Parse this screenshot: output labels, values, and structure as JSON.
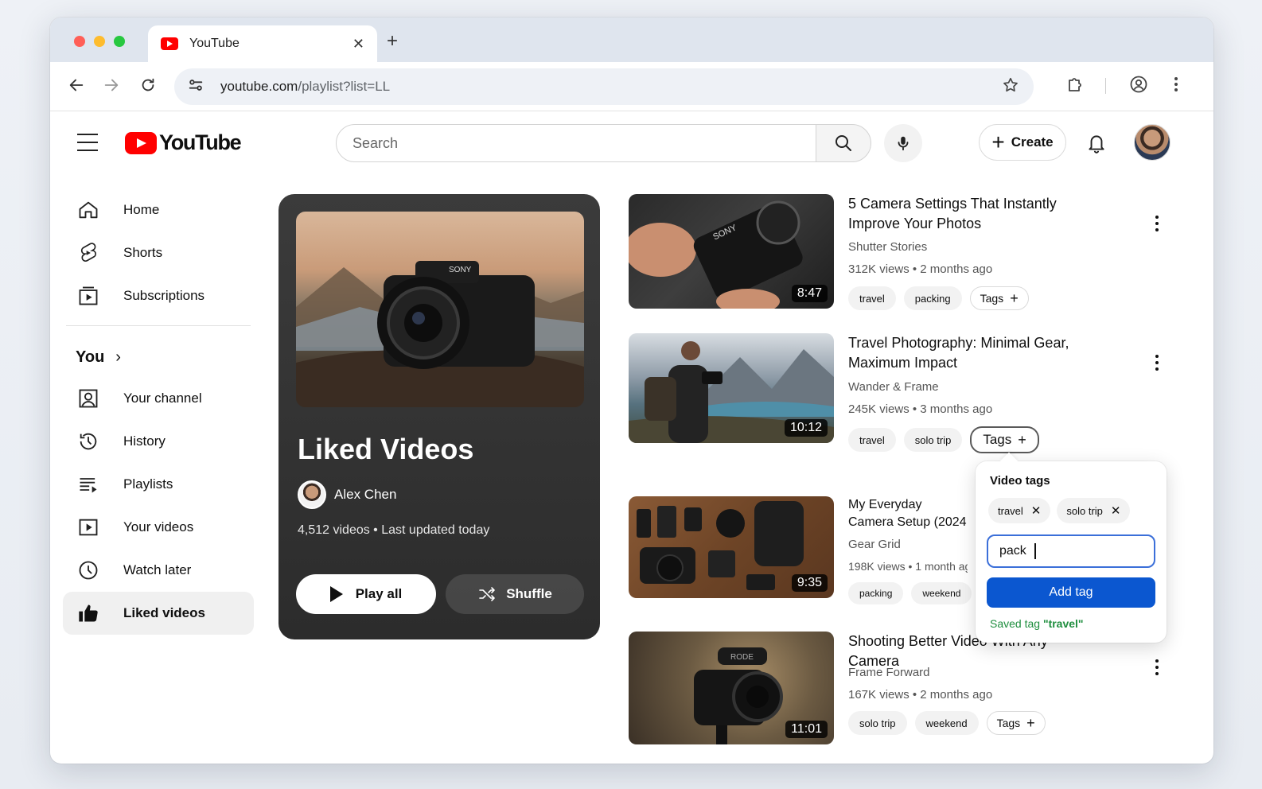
{
  "browser": {
    "tab_title": "YouTube",
    "tab_close": "✕",
    "new_tab": "+",
    "url_host": "youtube.com",
    "url_path": "/playlist?list=LL"
  },
  "header": {
    "logo_text": "YouTube",
    "search_placeholder": "Search",
    "create_label": "Create",
    "create_plus": "+"
  },
  "sidebar": {
    "top_items": [
      {
        "label": "Home",
        "icon": "home-icon"
      },
      {
        "label": "Shorts",
        "icon": "shorts-icon"
      },
      {
        "label": "Subscriptions",
        "icon": "subscriptions-icon"
      }
    ],
    "you_label": "You",
    "you_chevron": "›",
    "you_items": [
      {
        "label": "Your channel",
        "icon": "channel-icon"
      },
      {
        "label": "History",
        "icon": "history-icon"
      },
      {
        "label": "Playlists",
        "icon": "playlists-icon"
      },
      {
        "label": "Your videos",
        "icon": "your-videos-icon"
      },
      {
        "label": "Watch later",
        "icon": "clock-icon"
      },
      {
        "label": "Liked videos",
        "icon": "thumbs-up-icon",
        "active": true
      }
    ]
  },
  "playlist": {
    "title": "Liked Videos",
    "owner": "Alex Chen",
    "meta": "4,512 videos • Last updated today",
    "play_all": "Play all",
    "shuffle": "Shuffle"
  },
  "videos": [
    {
      "title": "5 Camera Settings That Instantly Improve Your Photos",
      "channel": "Shutter Stories",
      "meta": "312K views • 2 months ago",
      "duration": "8:47",
      "tags": [
        "travel",
        "packing"
      ],
      "tags_button": "Tags"
    },
    {
      "title": "Travel Photography: Minimal Gear, Maximum Impact",
      "channel": "Wander & Frame",
      "meta": "245K views • 3 months ago",
      "duration": "10:12",
      "tags": [
        "travel",
        "solo trip"
      ],
      "tags_button": "Tags"
    },
    {
      "title": "My Everyday Camera Setup (2024 Edition)",
      "title_visible": "My Everyday Camera ¦ (2024 Edition)",
      "channel": "Gear Grid",
      "meta": "198K views • 1 month ag",
      "duration": "9:35",
      "tags": [
        "packing",
        "weekend"
      ]
    },
    {
      "title": "Shooting Better Video With Any Camera",
      "channel": "Frame Forward",
      "meta": "167K views • 2 months ago",
      "duration": "11:01",
      "tags": [
        "solo trip",
        "weekend"
      ],
      "tags_button": "Tags"
    }
  ],
  "tag_popover": {
    "title": "Video tags",
    "tags": [
      "travel",
      "solo trip"
    ],
    "input_value": "pack",
    "button": "Add tag",
    "status_prefix": "Saved tag ",
    "status_tag": "\"travel\""
  },
  "colors": {
    "brand_red": "#ff0000",
    "primary_blue": "#0b57d0",
    "success_green": "#1e8e3e",
    "playlist_card": "#333333"
  }
}
